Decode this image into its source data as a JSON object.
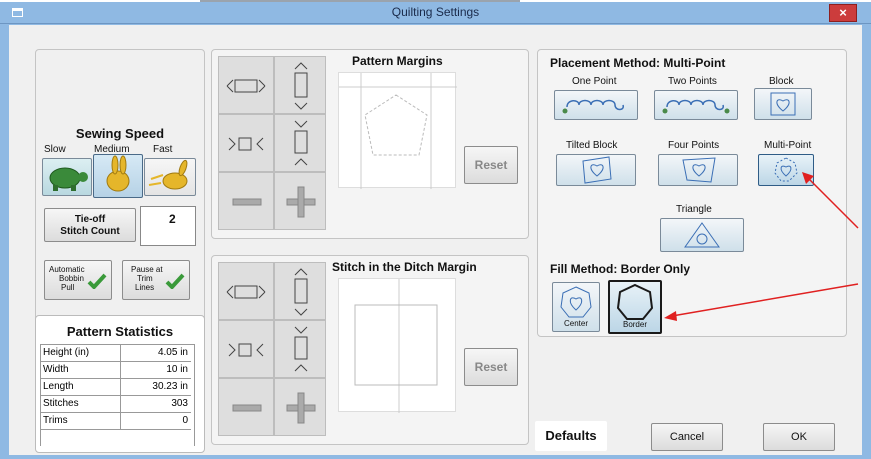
{
  "window": {
    "title": "Quilting Settings",
    "close": "×"
  },
  "sewing_speed": {
    "title": "Sewing Speed",
    "slow": "Slow",
    "medium": "Medium",
    "fast": "Fast"
  },
  "tieoff": {
    "label_line1": "Tie-off",
    "label_line2": "Stitch Count",
    "value": "2"
  },
  "auto_bobbin": {
    "line1": "Automatic",
    "line2": "Bobbin",
    "line3": "Pull"
  },
  "pause_trim": {
    "line1": "Pause at",
    "line2": "Trim",
    "line3": "Lines"
  },
  "pattern_statistics": {
    "title": "Pattern Statistics",
    "rows": [
      {
        "label": "Height (in)",
        "value": "4.05 in"
      },
      {
        "label": "Width",
        "value": "10 in"
      },
      {
        "label": "Length",
        "value": "30.23 in"
      },
      {
        "label": "Stitches",
        "value": "303"
      },
      {
        "label": "Trims",
        "value": "0"
      }
    ]
  },
  "pattern_margins": {
    "title": "Pattern Margins",
    "reset": "Reset"
  },
  "ditch_margin": {
    "title": "Stitch in the Ditch Margin",
    "reset": "Reset"
  },
  "placement": {
    "title": "Placement Method: Multi-Point",
    "one_point": "One Point",
    "two_points": "Two Points",
    "block": "Block",
    "tilted_block": "Tilted Block",
    "four_points": "Four Points",
    "multi_point": "Multi-Point",
    "triangle": "Triangle"
  },
  "fill": {
    "title": "Fill Method: Border Only",
    "center": "Center",
    "border": "Border"
  },
  "buttons": {
    "defaults": "Defaults",
    "cancel": "Cancel",
    "ok": "OK"
  },
  "colors": {
    "titlebar": "#8fb9e3",
    "close": "#cc3c3c",
    "arrow": "#e02020",
    "turtle": "#3a8a3a",
    "rabbit": "#e5b62a"
  }
}
